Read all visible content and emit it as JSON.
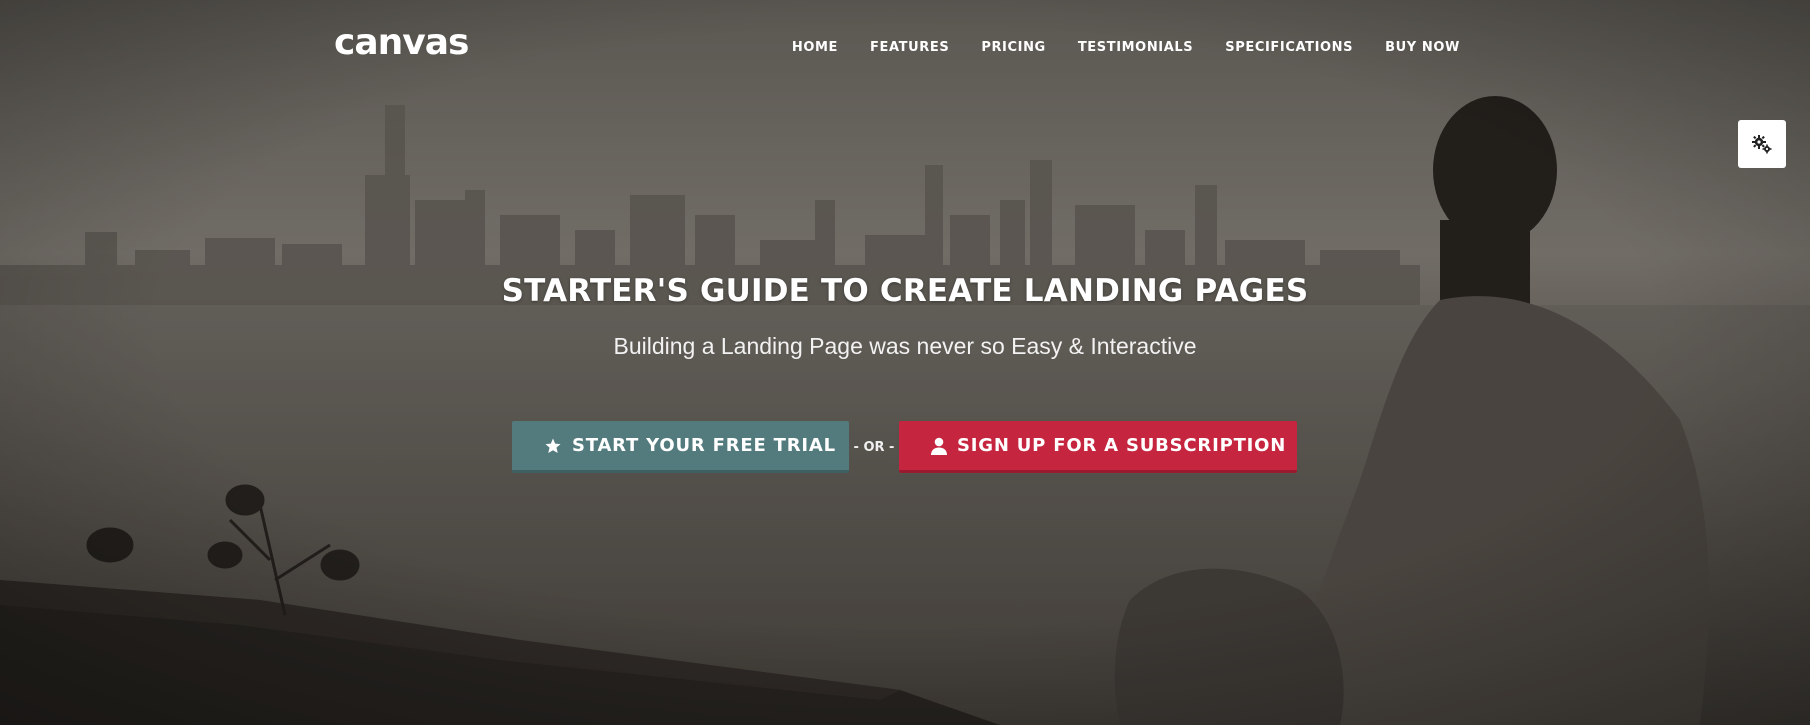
{
  "brand": {
    "logo_text": "canvas"
  },
  "nav": {
    "items": [
      {
        "label": "HOME"
      },
      {
        "label": "FEATURES"
      },
      {
        "label": "PRICING"
      },
      {
        "label": "TESTIMONIALS"
      },
      {
        "label": "SPECIFICATIONS"
      },
      {
        "label": "BUY NOW"
      }
    ]
  },
  "hero": {
    "title": "STARTER'S GUIDE TO CREATE LANDING PAGES",
    "subtitle": "Building a Landing Page was never so Easy & Interactive",
    "primary_cta": {
      "label": "START YOUR FREE TRIAL",
      "icon": "star-icon"
    },
    "separator": "- OR -",
    "secondary_cta": {
      "label": "SIGN UP FOR A SUBSCRIPTION",
      "icon": "user-icon"
    }
  },
  "settings_panel": {
    "icon": "gears-icon"
  },
  "colors": {
    "trial_button": "#537b7e",
    "signup_button": "#c5253f",
    "text": "#ffffff"
  }
}
